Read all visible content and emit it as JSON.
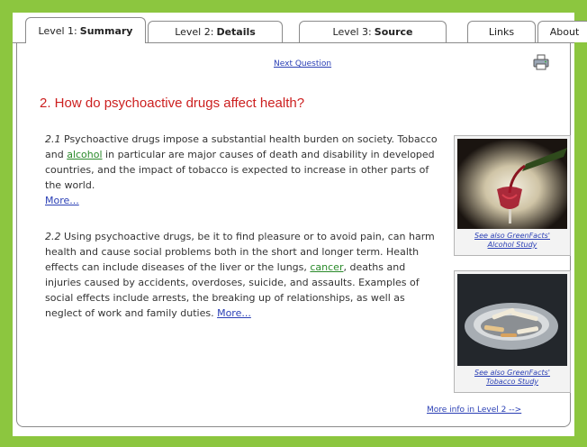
{
  "tabs": [
    {
      "prefix": "Level 1:",
      "name": "Summary",
      "active": true
    },
    {
      "prefix": "Level 2:",
      "name": "Details",
      "active": false
    },
    {
      "prefix": "Level 3:",
      "name": "Source",
      "active": false
    },
    {
      "prefix": "",
      "name": "Links",
      "active": false
    },
    {
      "prefix": "",
      "name": "About",
      "active": false
    }
  ],
  "nav": {
    "next_question": "Next Question",
    "print_icon": "printer-icon"
  },
  "title": "2. How do psychoactive drugs affect health?",
  "paragraphs": [
    {
      "num": "2.1",
      "before": "Psychoactive drugs impose a substantial health burden on society. Tobacco and ",
      "link": "alcohol",
      "after": " in particular are major causes of death and disability in developed countries, and the impact of tobacco is expected to increase in other parts of the world.",
      "more": "More..."
    },
    {
      "num": "2.2",
      "before": "Using psychoactive drugs, be it to find pleasure or to avoid pain, can harm health and cause social problems both in the short and longer term. Health effects can include diseases of the liver or the lungs, ",
      "link": "cancer",
      "after": ", deaths and injuries caused by accidents, overdoses, suicide, and assaults. Examples of social effects include arrests, the breaking up of relationships, as well as neglect of work and family duties. ",
      "more": "More..."
    }
  ],
  "figures": [
    {
      "caption_line1": "See also GreenFacts'",
      "caption_line2": "Alcohol Study"
    },
    {
      "caption_line1": "See also GreenFacts'",
      "caption_line2": "Tobacco Study"
    }
  ],
  "footer": {
    "more_info": "More info in Level 2 -->"
  },
  "colors": {
    "background": "#8cc63f",
    "title": "#cc1f1f",
    "link": "#2a3fb5",
    "glossary_link": "#2a8a2a"
  }
}
